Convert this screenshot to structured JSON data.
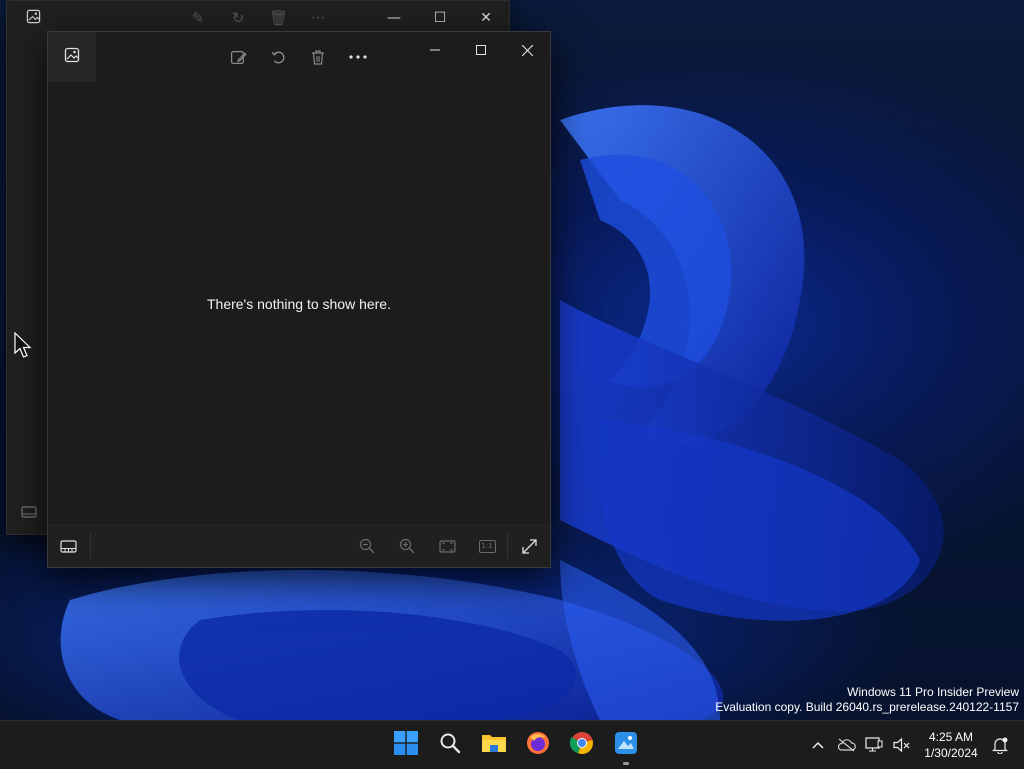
{
  "photos_window": {
    "empty_message": "There's nothing to show here.",
    "toolbar_tools": [
      "edit-image-icon",
      "rotate-icon",
      "delete-icon",
      "more-options-icon"
    ],
    "bottom_tools": [
      "zoom-out-icon",
      "zoom-in-icon",
      "fit-to-window-icon",
      "actual-size-icon"
    ],
    "actual_size_label": "1:1"
  },
  "watermark": {
    "line1": "Windows 11 Pro Insider Preview",
    "line2": "Evaluation copy. Build 26040.rs_prerelease.240122-1157"
  },
  "taskbar": {
    "apps": [
      "start-icon",
      "search-icon",
      "file-explorer-icon",
      "firefox-icon",
      "chrome-icon",
      "photos-icon"
    ],
    "time": "4:25 AM",
    "date": "1/30/2024"
  }
}
